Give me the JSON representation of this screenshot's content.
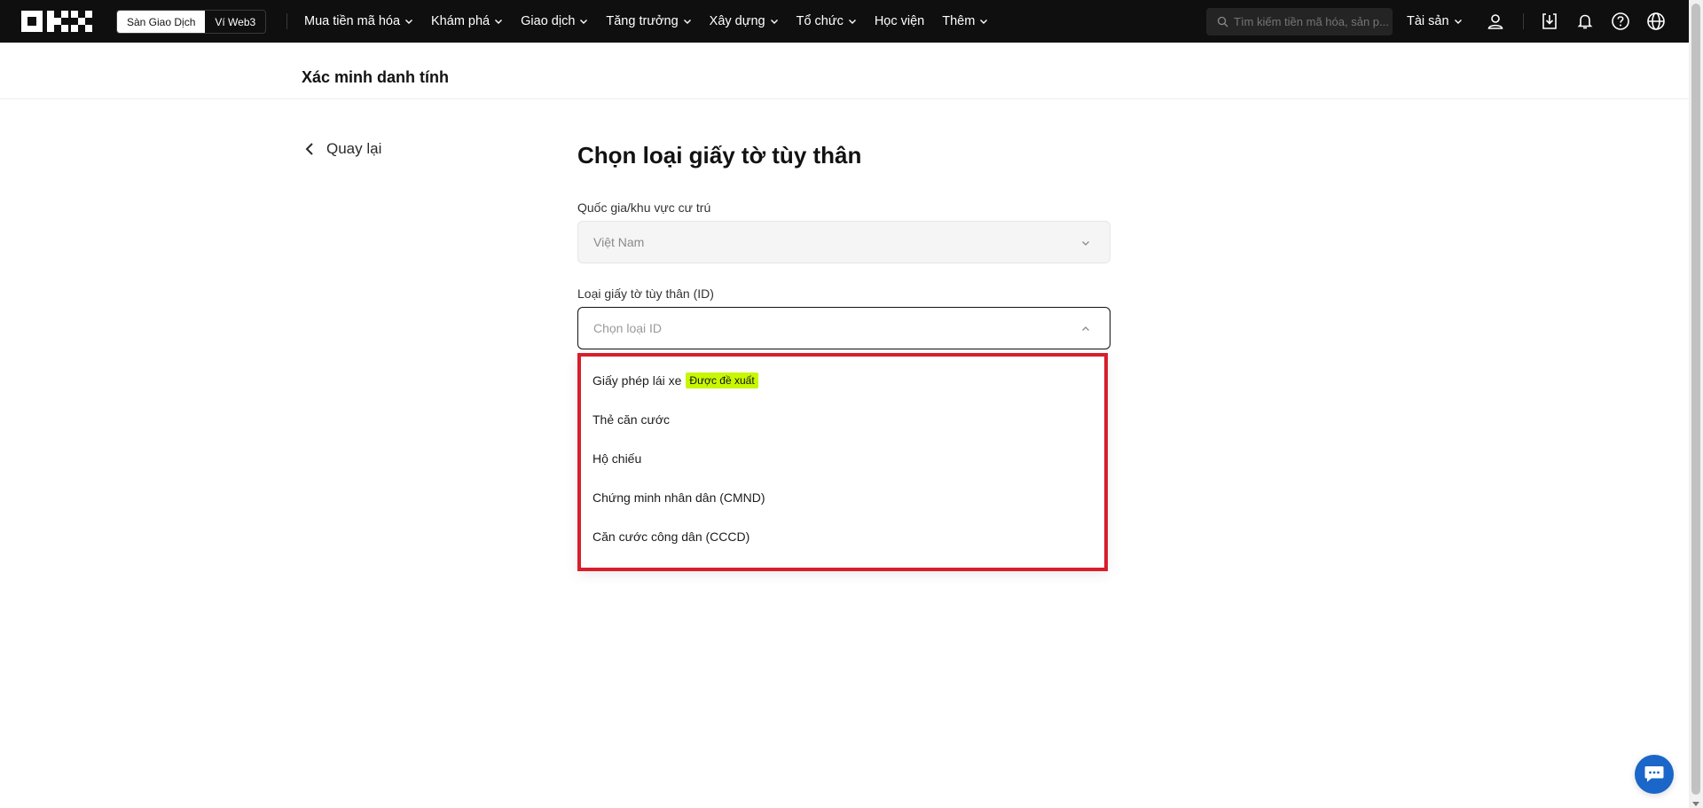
{
  "navbar": {
    "mode_toggle": {
      "exchange_label": "Sàn Giao Dịch",
      "web3_label": "Ví Web3"
    },
    "menu": [
      {
        "label": "Mua tiền mã hóa",
        "has_dropdown": true
      },
      {
        "label": "Khám phá",
        "has_dropdown": true
      },
      {
        "label": "Giao dịch",
        "has_dropdown": true
      },
      {
        "label": "Tăng trưởng",
        "has_dropdown": true
      },
      {
        "label": "Xây dựng",
        "has_dropdown": true
      },
      {
        "label": "Tổ chức",
        "has_dropdown": true
      },
      {
        "label": "Học viện",
        "has_dropdown": false
      },
      {
        "label": "Thêm",
        "has_dropdown": true
      }
    ],
    "search_placeholder": "Tìm kiếm tiền mã hóa, sản p...",
    "assets_label": "Tài sản",
    "icons": [
      "user-icon",
      "download-icon",
      "bell-icon",
      "help-icon",
      "globe-icon"
    ]
  },
  "subheader": {
    "title": "Xác minh danh tính"
  },
  "back": {
    "label": "Quay lại"
  },
  "form": {
    "title": "Chọn loại giấy tờ tùy thân",
    "country": {
      "label": "Quốc gia/khu vực cư trú",
      "value": "Việt Nam"
    },
    "id_type": {
      "label": "Loại giấy tờ tùy thân (ID)",
      "placeholder": "Chọn loại ID"
    }
  },
  "dropdown": {
    "options": [
      {
        "label": "Giấy phép lái xe",
        "badge": "Được đề xuất"
      },
      {
        "label": "Thẻ căn cước",
        "badge": ""
      },
      {
        "label": "Hộ chiếu",
        "badge": ""
      },
      {
        "label": "Chứng minh nhân dân (CMND)",
        "badge": ""
      },
      {
        "label": "Căn cước công dân (CCCD)",
        "badge": ""
      }
    ],
    "highlight_color": "#d81e2c",
    "badge_color": "#c7f702"
  },
  "colors": {
    "navbar_bg": "#0f0f0f",
    "chat_button": "#1a66c9"
  }
}
